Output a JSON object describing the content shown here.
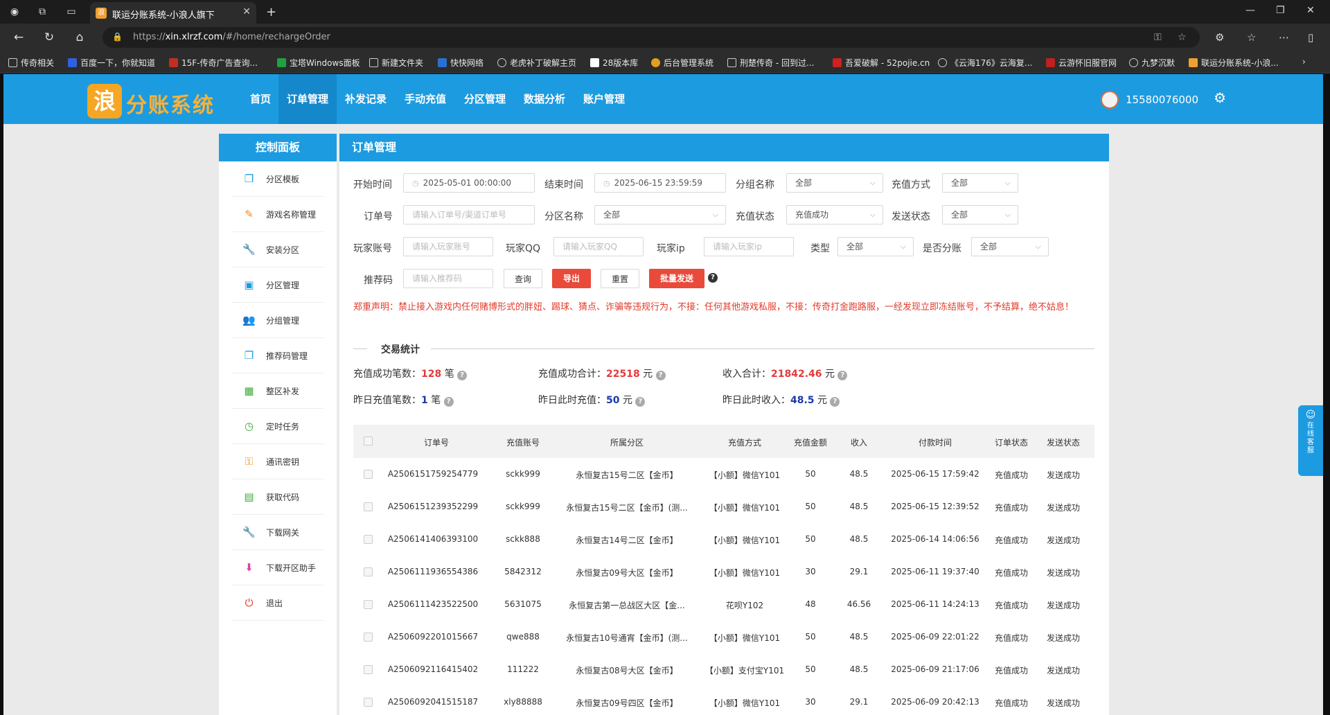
{
  "browser": {
    "tab_title": "联运分账系统-小浪人旗下",
    "tab_favicon": "浪",
    "url_host": "xin.xlrzf.com",
    "url_path": "/#/home/rechargeOrder",
    "url_scheme": "https://",
    "bookmarks": [
      "传奇相关",
      "百度一下，你就知道",
      "15F-传奇广告查询...",
      "宝塔Windows面板",
      "新建文件夹",
      "快快网络",
      "老虎补丁破解主页",
      "28版本库",
      "后台管理系统",
      "刑楚传奇 - 回到过...",
      "吾爱破解 - 52pojie.cn",
      "《云海176》云海复...",
      "云游怀旧服官网",
      "九梦沉默",
      "联运分账系统-小浪..."
    ]
  },
  "header": {
    "logo_badge": "浪",
    "logo_text": "分账系统",
    "nav": [
      "首页",
      "订单管理",
      "补发记录",
      "手动充值",
      "分区管理",
      "数据分析",
      "账户管理"
    ],
    "active_nav": 1,
    "username": "15580076000"
  },
  "sidebar": {
    "title": "控制面板",
    "items": [
      {
        "label": "分区模板",
        "icon": "copy-icon",
        "color": "#1d9be0",
        "glyph": "❐"
      },
      {
        "label": "游戏名称管理",
        "icon": "pencil-icon",
        "color": "#f08a24",
        "glyph": "✎"
      },
      {
        "label": "安装分区",
        "icon": "wrench-icon",
        "color": "#3aaa35",
        "glyph": "🔧"
      },
      {
        "label": "分区管理",
        "icon": "inbox-icon",
        "color": "#1d9be0",
        "glyph": "▣"
      },
      {
        "label": "分组管理",
        "icon": "users-icon",
        "color": "#3aaa35",
        "glyph": "👥"
      },
      {
        "label": "推荐码管理",
        "icon": "copy-icon",
        "color": "#1d9be0",
        "glyph": "❐"
      },
      {
        "label": "整区补发",
        "icon": "calendar-icon",
        "color": "#3aaa35",
        "glyph": "▦"
      },
      {
        "label": "定时任务",
        "icon": "clock-calendar-icon",
        "color": "#3aaa35",
        "glyph": "◷"
      },
      {
        "label": "通讯密钥",
        "icon": "key-icon",
        "color": "#f08a24",
        "glyph": "⚿"
      },
      {
        "label": "获取代码",
        "icon": "briefcase-icon",
        "color": "#3aaa35",
        "glyph": "▤"
      },
      {
        "label": "下载网关",
        "icon": "wrench-icon",
        "color": "#3aaa35",
        "glyph": "🔧"
      },
      {
        "label": "下载开区助手",
        "icon": "download-box-icon",
        "color": "#e040a0",
        "glyph": "⬇"
      },
      {
        "label": "退出",
        "icon": "power-icon",
        "color": "#e23a2a",
        "glyph": "⏻"
      }
    ]
  },
  "main": {
    "title": "订单管理",
    "filters": {
      "start_time_label": "开始时间",
      "start_time_value": "2025-05-01 00:00:00",
      "end_time_label": "结束时间",
      "end_time_value": "2025-06-15 23:59:59",
      "group_label": "分组名称",
      "group_value": "全部",
      "method_label": "充值方式",
      "method_value": "全部",
      "order_no_label": "订单号",
      "order_no_placeholder": "请输入订单号/渠道订单号",
      "zone_label": "分区名称",
      "zone_value": "全部",
      "status_label": "充值状态",
      "status_value": "充值成功",
      "send_label": "发送状态",
      "send_value": "全部",
      "account_label": "玩家账号",
      "account_placeholder": "请输入玩家账号",
      "qq_label": "玩家QQ",
      "qq_placeholder": "请输入玩家QQ",
      "ip_label": "玩家ip",
      "ip_placeholder": "请输入玩家ip",
      "type_label": "类型",
      "type_value": "全部",
      "split_label": "是否分账",
      "split_value": "全部",
      "ref_label": "推荐码",
      "ref_placeholder": "请输入推荐码"
    },
    "buttons": {
      "query": "查询",
      "export": "导出",
      "reset": "重置",
      "batch_send": "批量发送"
    },
    "notice": "郑重声明：禁止接入游戏内任何赌博形式的胖妞、踢球、猜点、诈骗等违规行为，不接：任何其他游戏私服，不接：传奇打金跑路服，一经发现立即冻结账号，不予结算，绝不姑息！",
    "stats": {
      "section_title": "交易统计",
      "success_count_label": "充值成功笔数：",
      "success_count": "128",
      "count_unit": "笔",
      "success_total_label": "充值成功合计：",
      "success_total": "22518",
      "yuan": "元",
      "income_label": "收入合计：",
      "income_total": "21842.46",
      "yesterday_count_label": "昨日充值笔数：",
      "yesterday_count": "1",
      "yesterday_recharge_label": "昨日此时充值：",
      "yesterday_recharge": "50",
      "yesterday_income_label": "昨日此时收入：",
      "yesterday_income": "48.5"
    },
    "table": {
      "headers": [
        "订单号",
        "充值账号",
        "所属分区",
        "充值方式",
        "充值金额",
        "收入",
        "付款时间",
        "订单状态",
        "发送状态"
      ],
      "rows": [
        [
          "A2506151759254779",
          "sckk999",
          "永恒复古15号二区【金币】",
          "【小额】微信Y101",
          "50",
          "48.5",
          "2025-06-15 17:59:42",
          "充值成功",
          "发送成功"
        ],
        [
          "A2506151239352299",
          "sckk999",
          "永恒复古15号二区【金币】(测...",
          "【小额】微信Y101",
          "50",
          "48.5",
          "2025-06-15 12:39:52",
          "充值成功",
          "发送成功"
        ],
        [
          "A2506141406393100",
          "sckk888",
          "永恒复古14号二区【金币】",
          "【小额】微信Y101",
          "50",
          "48.5",
          "2025-06-14 14:06:56",
          "充值成功",
          "发送成功"
        ],
        [
          "A2506111936554386",
          "5842312",
          "永恒复古09号大区【金币】",
          "【小额】微信Y101",
          "30",
          "29.1",
          "2025-06-11 19:37:40",
          "充值成功",
          "发送成功"
        ],
        [
          "A2506111423522500",
          "5631075",
          "永恒复古第一总战区大区【金...",
          "花呗Y102",
          "48",
          "46.56",
          "2025-06-11 14:24:13",
          "充值成功",
          "发送成功"
        ],
        [
          "A2506092201015667",
          "qwe888",
          "永恒复古10号通宵【金币】(测...",
          "【小额】微信Y101",
          "50",
          "48.5",
          "2025-06-09 22:01:22",
          "充值成功",
          "发送成功"
        ],
        [
          "A2506092116415402",
          "111222",
          "永恒复古08号大区【金币】",
          "【小额】支付宝Y101",
          "50",
          "48.5",
          "2025-06-09 21:17:06",
          "充值成功",
          "发送成功"
        ],
        [
          "A2506092041515187",
          "xly88888",
          "永恒复古09号四区【金币】",
          "【小额】微信Y101",
          "30",
          "29.1",
          "2025-06-09 20:42:13",
          "充值成功",
          "发送成功"
        ]
      ]
    }
  },
  "support_widget": "在线客服"
}
